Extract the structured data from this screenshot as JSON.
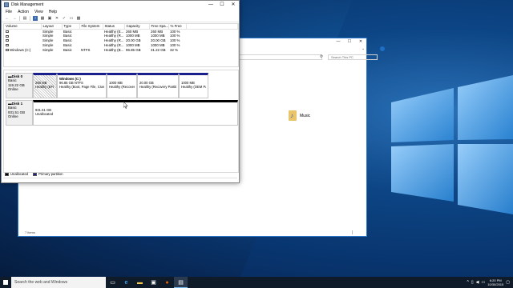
{
  "disk_management": {
    "title": "Disk Management",
    "window_controls": [
      "—",
      "☐",
      "✕"
    ],
    "menu": [
      "File",
      "Action",
      "View",
      "Help"
    ],
    "toolbar": [
      "back-icon",
      "forward-icon",
      "list-icon",
      "help-icon",
      "properties-icon",
      "refresh-icon",
      "delete-icon",
      "check-icon",
      "open-icon",
      "rescan-icon"
    ],
    "columns": [
      "Volume",
      "Layout",
      "Type",
      "File System",
      "Status",
      "Capacity",
      "Free Spa...",
      "% Free"
    ],
    "rows": [
      [
        "",
        "Simple",
        "Basic",
        "",
        "Healthy (E...",
        "260 MB",
        "260 MB",
        "100 %"
      ],
      [
        "",
        "Simple",
        "Basic",
        "",
        "Healthy (R...",
        "1000 MB",
        "1000 MB",
        "100 %"
      ],
      [
        "",
        "Simple",
        "Basic",
        "",
        "Healthy (R...",
        "20.00 GB",
        "20.00 GB",
        "100 %"
      ],
      [
        "",
        "Simple",
        "Basic",
        "",
        "Healthy (R...",
        "1000 MB",
        "1000 MB",
        "100 %"
      ],
      [
        "Windows (C:)",
        "Simple",
        "Basic",
        "NTFS",
        "Healthy (B...",
        "96.85 GB",
        "31.22 GB",
        "32 %"
      ]
    ],
    "disk0": {
      "name": "Disk 0",
      "type": "Basic",
      "size": "119.22 GB",
      "status": "Online",
      "partitions": [
        {
          "title": "",
          "size": "260 MB",
          "status": "Healthy (EFI S"
        },
        {
          "title": "Windows (C:)",
          "size": "96.85 GB NTFS",
          "status": "Healthy (Boot, Page File, Crash D"
        },
        {
          "title": "",
          "size": "1000 MB",
          "status": "Healthy (Recovery"
        },
        {
          "title": "",
          "size": "20.00 GB",
          "status": "Healthy (Recovery Partition"
        },
        {
          "title": "",
          "size": "1000 MB",
          "status": "Healthy (OEM Part"
        }
      ]
    },
    "disk1": {
      "name": "Disk 1",
      "type": "Basic",
      "size": "931.51 GB",
      "status": "Online",
      "partition": {
        "size": "931.51 GB",
        "status": "Unallocated"
      }
    },
    "legend": [
      {
        "label": "Unallocated",
        "color": "#000000"
      },
      {
        "label": "Primary partition",
        "color": "#1b1f8c"
      }
    ]
  },
  "explorer": {
    "search_placeholder": "Search This PC",
    "folder_music": "Music",
    "status_text": "7 items"
  },
  "taskbar": {
    "search_placeholder": "Search the web and Windows",
    "time": "6:20 PM",
    "date": "10/30/2015"
  },
  "colors": {
    "primary_partition": "#1b1f8c",
    "unallocated": "#000000",
    "taskbar": "#101b29"
  }
}
